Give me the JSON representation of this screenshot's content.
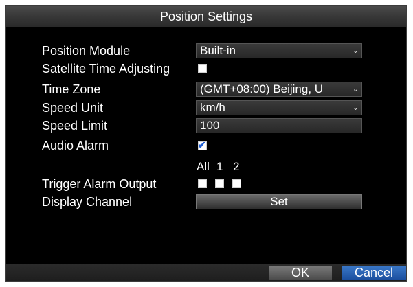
{
  "title": "Position Settings",
  "fields": {
    "position_module": {
      "label": "Position Module",
      "value": "Built-in"
    },
    "satellite_time": {
      "label": "Satellite Time Adjusting",
      "checked": false
    },
    "time_zone": {
      "label": "Time Zone",
      "value": "(GMT+08:00) Beijing, U"
    },
    "speed_unit": {
      "label": "Speed Unit",
      "value": "km/h"
    },
    "speed_limit": {
      "label": "Speed Limit",
      "value": "100"
    },
    "audio_alarm": {
      "label": "Audio Alarm",
      "checked": true
    },
    "trigger_alarm_output": {
      "label": "Trigger Alarm Output",
      "headers": [
        "All",
        "1",
        "2"
      ],
      "checked": [
        false,
        false,
        false
      ]
    },
    "display_channel": {
      "label": "Display Channel",
      "button": "Set"
    }
  },
  "dropdown_arrow": "⌄",
  "checkmark": "✔",
  "buttons": {
    "ok": "OK",
    "cancel": "Cancel"
  },
  "colors": {
    "accent_blue": "#1f5fd6",
    "cancel_button": "#1a4e9e",
    "background": "#000000"
  }
}
